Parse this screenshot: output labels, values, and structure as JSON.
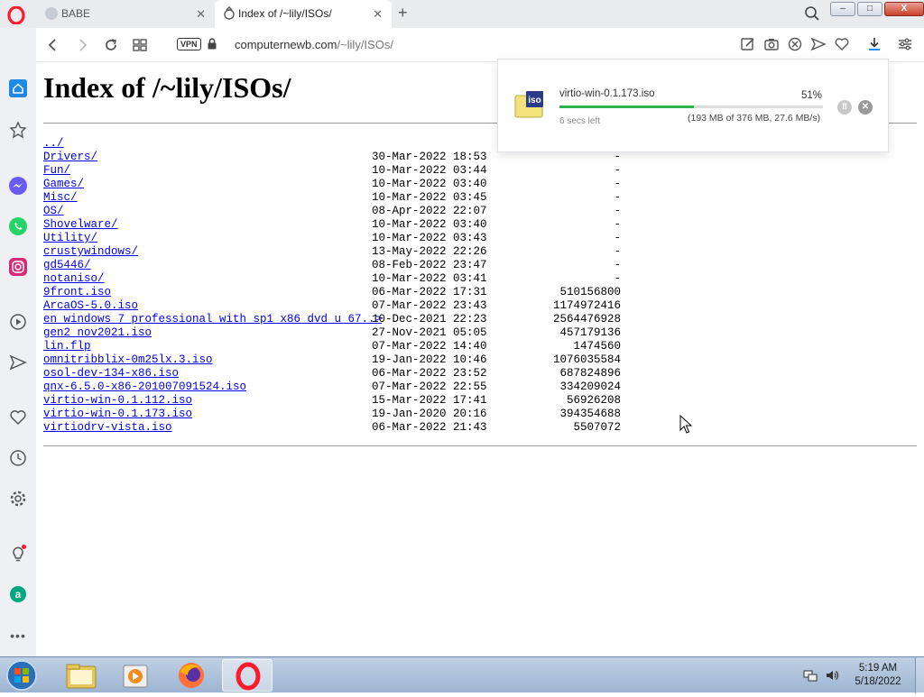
{
  "browser": {
    "tabs": [
      {
        "title": "BABE",
        "active": false
      },
      {
        "title": "Index of /~lily/ISOs/",
        "active": true
      }
    ],
    "new_tab_symbol": "+",
    "close_symbol": "✕",
    "address": {
      "vpn_label": "VPN",
      "domain": "computernewb.com",
      "path": "/~lily/ISOs/"
    },
    "window_buttons": [
      "–",
      "□",
      "X"
    ],
    "accent_color": "#ff1b2d"
  },
  "sidebar": {
    "icons": [
      "home-icon",
      "bookmarks-icon",
      "messenger-icon",
      "whatsapp-icon",
      "instagram-icon",
      "player-icon",
      "flow-icon",
      "heart-icon",
      "history-icon",
      "settings-icon",
      "tips-icon",
      "aria-icon",
      "more-icon"
    ],
    "more_label": "•••"
  },
  "page": {
    "title": "Index of /~lily/ISOs/",
    "entries": [
      {
        "name": "../",
        "date": "",
        "size": ""
      },
      {
        "name": "Drivers/",
        "date": "30-Mar-2022 18:53",
        "size": "-"
      },
      {
        "name": "Fun/",
        "date": "10-Mar-2022 03:44",
        "size": "-"
      },
      {
        "name": "Games/",
        "date": "10-Mar-2022 03:40",
        "size": "-"
      },
      {
        "name": "Misc/",
        "date": "10-Mar-2022 03:45",
        "size": "-"
      },
      {
        "name": "OS/",
        "date": "08-Apr-2022 22:07",
        "size": "-"
      },
      {
        "name": "Shovelware/",
        "date": "10-Mar-2022 03:40",
        "size": "-"
      },
      {
        "name": "Utility/",
        "date": "10-Mar-2022 03:43",
        "size": "-"
      },
      {
        "name": "crustywindows/",
        "date": "13-May-2022 22:26",
        "size": "-"
      },
      {
        "name": "gd5446/",
        "date": "08-Feb-2022 23:47",
        "size": "-"
      },
      {
        "name": "notaniso/",
        "date": "10-Mar-2022 03:41",
        "size": "-"
      },
      {
        "name": "9front.iso",
        "date": "06-Mar-2022 17:31",
        "size": "510156800"
      },
      {
        "name": "ArcaOS-5.0.iso",
        "date": "07-Mar-2022 23:43",
        "size": "1174972416"
      },
      {
        "name": "en_windows_7_professional_with_sp1_x86_dvd_u_67..>",
        "date": "10-Dec-2021 22:23",
        "size": "2564476928"
      },
      {
        "name": "gen2_nov2021.iso",
        "date": "27-Nov-2021 05:05",
        "size": "457179136"
      },
      {
        "name": "lin.flp",
        "date": "07-Mar-2022 14:40",
        "size": "1474560"
      },
      {
        "name": "omnitribblix-0m25lx.3.iso",
        "date": "19-Jan-2022 10:46",
        "size": "1076035584"
      },
      {
        "name": "osol-dev-134-x86.iso",
        "date": "06-Mar-2022 23:52",
        "size": "687824896"
      },
      {
        "name": "qnx-6.5.0-x86-201007091524.iso",
        "date": "07-Mar-2022 22:55",
        "size": "334209024"
      },
      {
        "name": "virtio-win-0.1.112.iso",
        "date": "15-Mar-2022 17:41",
        "size": "56926208"
      },
      {
        "name": "virtio-win-0.1.173.iso",
        "date": "19-Jan-2020 20:16",
        "size": "394354688"
      },
      {
        "name": "virtiodrv-vista.iso",
        "date": "06-Mar-2022 21:43",
        "size": "5507072"
      }
    ]
  },
  "download": {
    "icon_label": "iso",
    "filename": "virtio-win-0.1.173.iso",
    "percent_label": "51%",
    "progress_fraction": 0.51,
    "time_left": "6 secs left",
    "detail": "(193 MB of 376 MB, 27.6 MB/s)",
    "pause_symbol": "II",
    "cancel_symbol": "✕"
  },
  "taskbar": {
    "apps": [
      "explorer-icon",
      "media-player-icon",
      "firefox-icon",
      "opera-icon"
    ],
    "clock_time": "5:19 AM",
    "clock_date": "5/18/2022"
  }
}
